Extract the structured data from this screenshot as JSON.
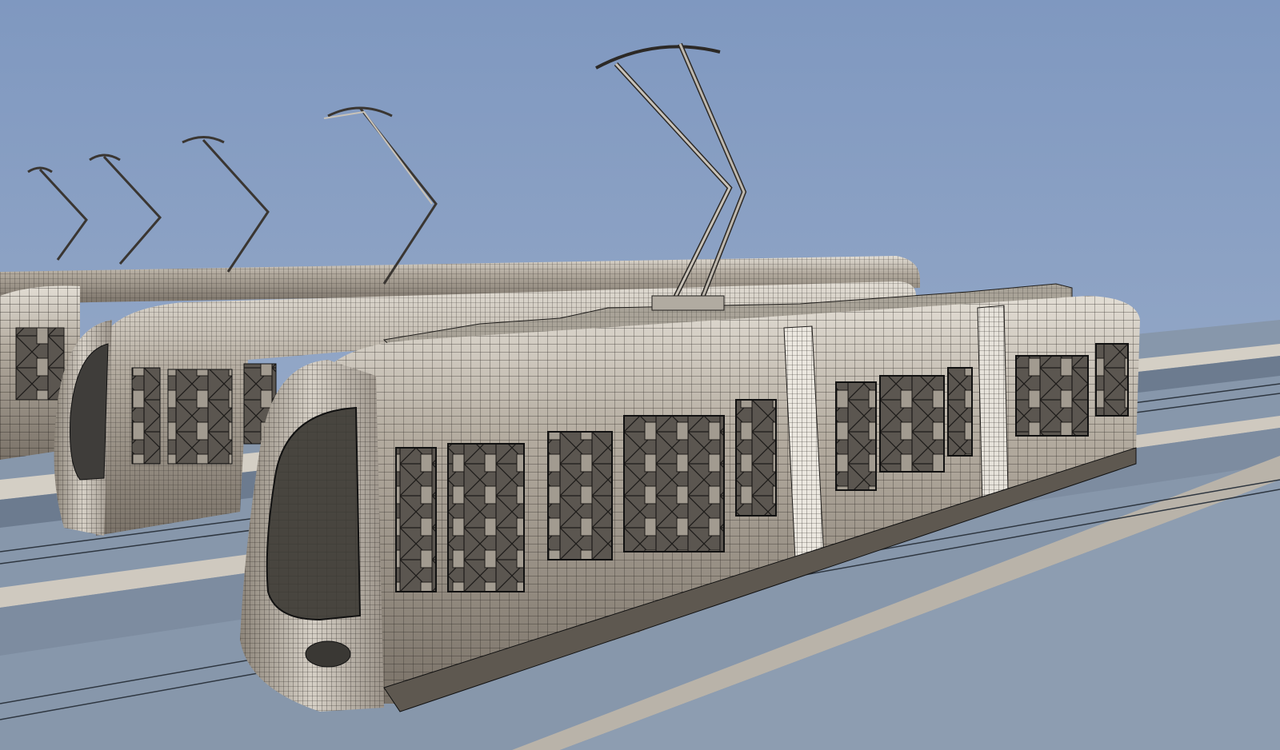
{
  "scene": {
    "colors": {
      "sky_top": "#7f98c0",
      "sky_bottom": "#a4b4cc",
      "ground": "#8a9cb0",
      "ground_dark": "#56657a",
      "platform_face": "#cfcac0",
      "platform_top": "#9aa9b8",
      "tram_body": "#a69f94",
      "tram_body_light": "#d8d2c8",
      "tram_body_dark": "#6d665e",
      "wire": "#1a1a1a",
      "glass": "#4a4a4a",
      "pantograph": "#b8b2a8"
    },
    "icons": [
      "tram-icon",
      "pantograph-icon"
    ]
  }
}
